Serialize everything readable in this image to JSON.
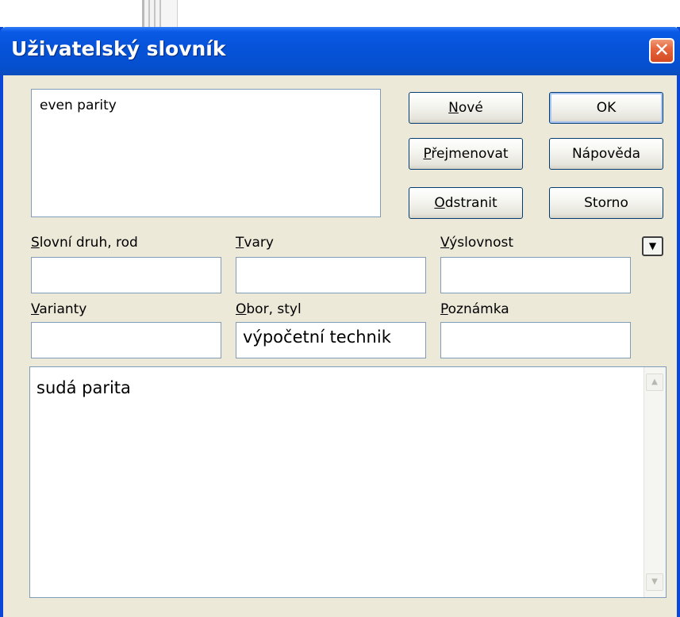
{
  "dialog": {
    "title": "Uživatelský slovník",
    "close_icon": "close-icon",
    "close_glyph": "✕"
  },
  "word_list": {
    "items": [
      "even parity"
    ]
  },
  "buttons": {
    "new": {
      "mnemonic": "N",
      "rest": "ové"
    },
    "rename": {
      "mnemonic": "P",
      "rest": "řejmenovat"
    },
    "delete": {
      "mnemonic": "O",
      "rest": "dstranit"
    },
    "ok": "OK",
    "help": "Nápověda",
    "cancel": "Storno"
  },
  "fields": {
    "part_of_speech": {
      "mnemonic": "S",
      "rest": "lovní druh, rod",
      "value": ""
    },
    "forms": {
      "mnemonic": "T",
      "rest": "vary",
      "value": ""
    },
    "pronunciation": {
      "mnemonic": "V",
      "rest": "ýslovnost",
      "value": ""
    },
    "variants": {
      "mnemonic": "V",
      "rest": "arianty",
      "value": ""
    },
    "domain_style": {
      "mnemonic": "O",
      "rest": "bor, styl",
      "value": "výpočetní technik"
    },
    "note": {
      "mnemonic": "P",
      "rest": "oznámka",
      "value": ""
    }
  },
  "expand_button": {
    "icon": "chevron-down-icon",
    "glyph": "▼"
  },
  "translation": {
    "text": "sudá parita",
    "scroll_up_glyph": "▲",
    "scroll_down_glyph": "▼"
  }
}
